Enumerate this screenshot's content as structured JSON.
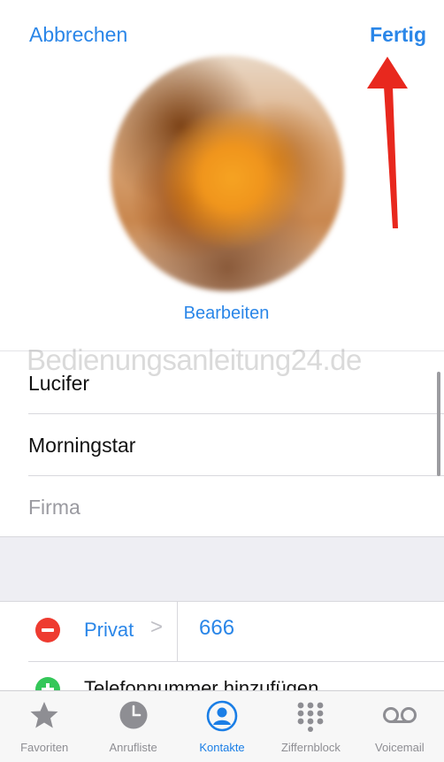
{
  "nav": {
    "cancel_label": "Abbrechen",
    "done_label": "Fertig"
  },
  "photo": {
    "edit_label": "Bearbeiten"
  },
  "watermark": "Bedienungsanleitung24.de",
  "fields": {
    "first_name": "Lucifer",
    "last_name": "Morningstar",
    "company_placeholder": "Firma"
  },
  "phone": {
    "label": "Privat",
    "chevron": ">",
    "number": "666"
  },
  "add_phone_label": "Telefonnummer hinzufügen",
  "tabs": [
    {
      "label": "Favoriten",
      "icon": "star-icon",
      "active": false
    },
    {
      "label": "Anrufliste",
      "icon": "clock-icon",
      "active": false
    },
    {
      "label": "Kontakte",
      "icon": "contacts-icon",
      "active": true
    },
    {
      "label": "Ziffernblock",
      "icon": "keypad-icon",
      "active": false
    },
    {
      "label": "Voicemail",
      "icon": "voicemail-icon",
      "active": false
    }
  ],
  "colors": {
    "accent": "#2a86e8",
    "delete": "#ee3b30",
    "add": "#34c759",
    "arrow": "#e8281e"
  }
}
